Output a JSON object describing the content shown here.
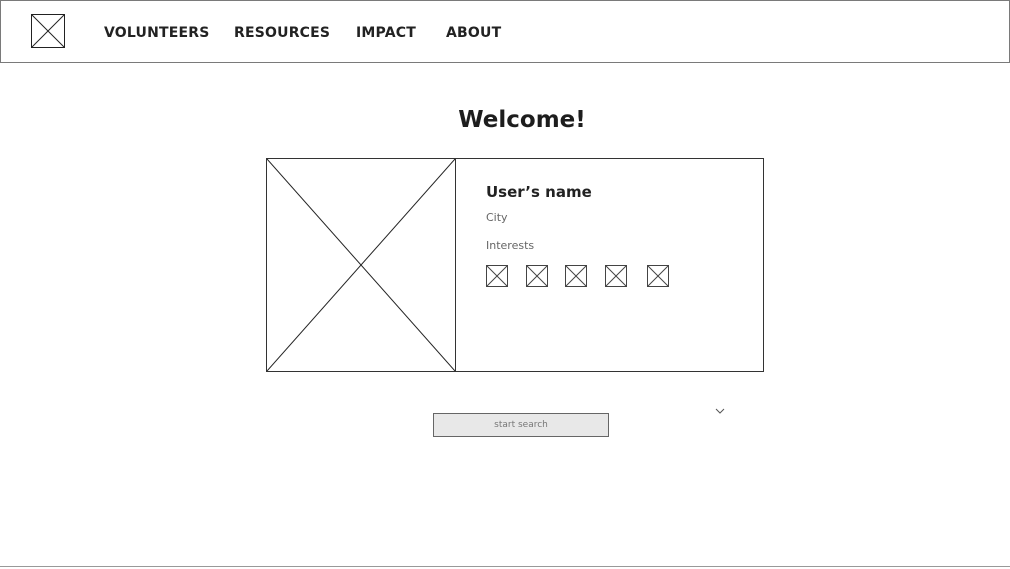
{
  "header": {
    "logo_icon": "image-placeholder-icon",
    "nav": [
      {
        "label": "VOLUNTEERS"
      },
      {
        "label": "RESOURCES"
      },
      {
        "label": "IMPACT"
      },
      {
        "label": "ABOUT"
      }
    ]
  },
  "main": {
    "welcome": "Welcome!",
    "profile": {
      "photo_icon": "image-placeholder-icon",
      "name": "User’s name",
      "city": "City",
      "interests_label": "Interests",
      "interest_icons": [
        "image-placeholder-icon",
        "image-placeholder-icon",
        "image-placeholder-icon",
        "image-placeholder-icon",
        "image-placeholder-icon"
      ]
    },
    "search_button": "start search",
    "dropdown_icon": "chevron-down-icon"
  }
}
